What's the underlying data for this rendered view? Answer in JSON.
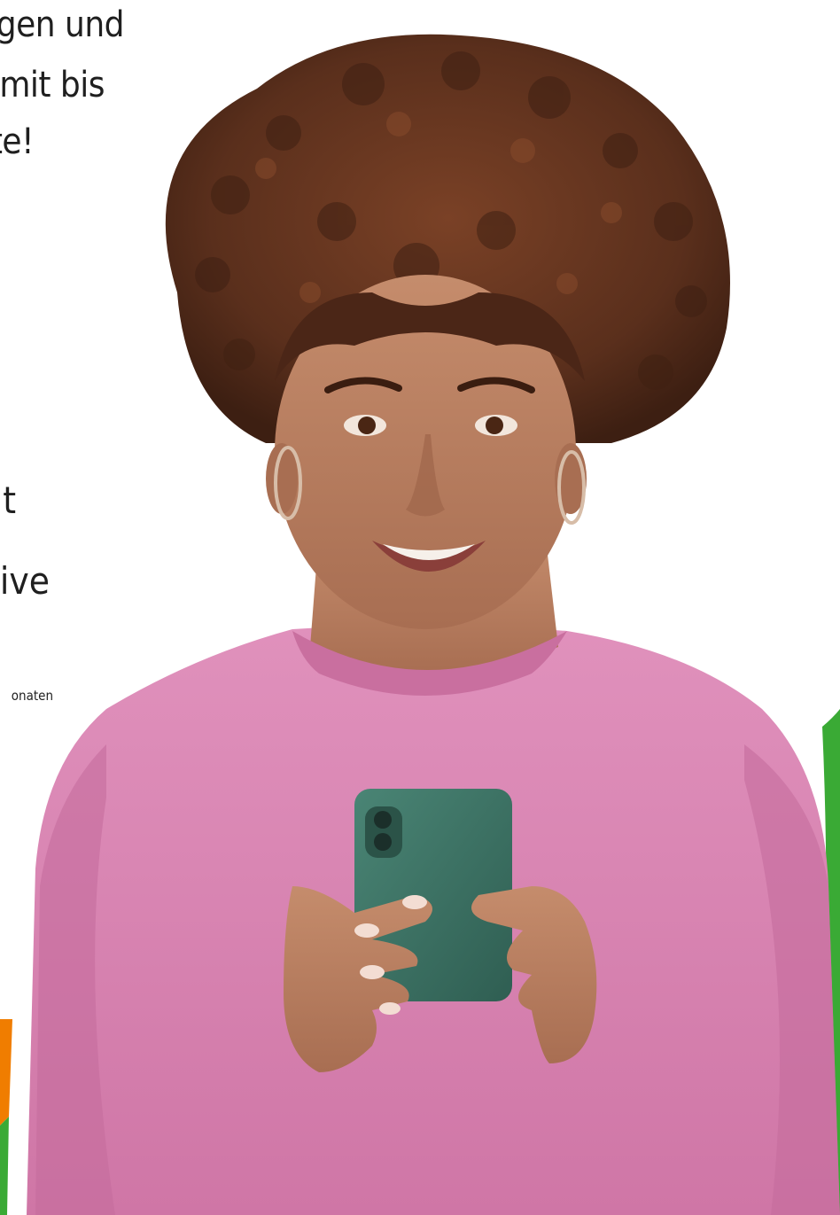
{
  "hero": {
    "headline_lines": [
      "gen und",
      "mit bis",
      "te!"
    ],
    "subtext_lines": [
      "t",
      "ive"
    ],
    "footnote": "onaten"
  },
  "colors": {
    "brand_green": "#3aaa35",
    "accent_orange": "#f07d00",
    "sweater_pink": "#d885b1",
    "hair_brown": "#5a2f1c",
    "skin": "#b57c5f",
    "phone_case": "#3f7566",
    "text": "#1f1f1f"
  },
  "image": {
    "subject": "person-holding-smartphone-photo"
  }
}
